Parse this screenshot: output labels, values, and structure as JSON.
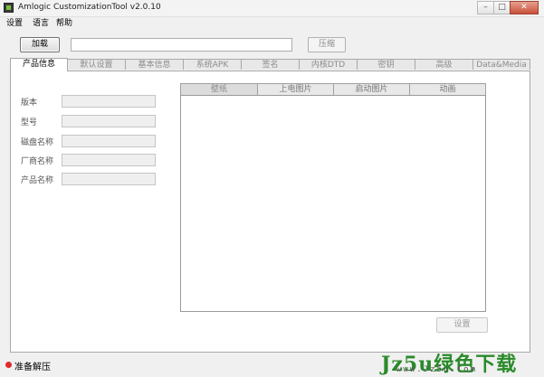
{
  "window": {
    "title": "Amlogic CustomizationTool v2.0.10",
    "minimize": "–",
    "maximize": "□",
    "close": "✕"
  },
  "menu": [
    "设置",
    "语言",
    "帮助"
  ],
  "toolbar": {
    "load_label": "加载",
    "path_value": "",
    "compress_label": "压缩"
  },
  "tabs": [
    "产品信息",
    "默认设置",
    "基本信息",
    "系统APK",
    "签名",
    "内核DTD",
    "密钥",
    "高级",
    "Data&Media"
  ],
  "fields": [
    {
      "label": "版本",
      "value": ""
    },
    {
      "label": "型号",
      "value": ""
    },
    {
      "label": "磁盘名称",
      "value": ""
    },
    {
      "label": "厂商名称",
      "value": ""
    },
    {
      "label": "产品名称",
      "value": ""
    }
  ],
  "inner_tabs": [
    "壁纸",
    "上电图片",
    "启动图片",
    "动画"
  ],
  "set_label": "设置",
  "status": {
    "text": "准备解压",
    "color": "#e02a2a"
  },
  "watermark": {
    "logo": "Jz5u绿色下载",
    "url": "www.Jz5u.Com"
  }
}
